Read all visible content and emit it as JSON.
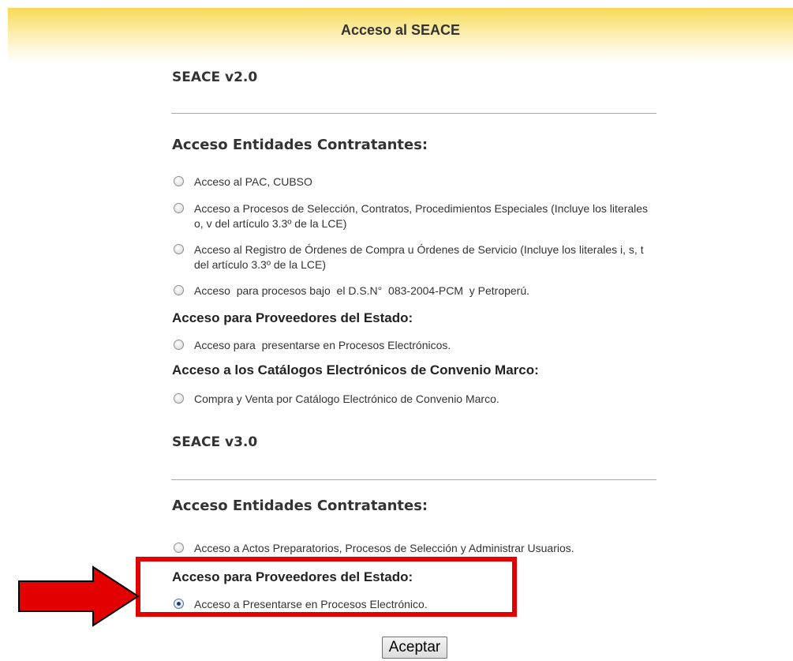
{
  "header": {
    "title": "Acceso al SEACE"
  },
  "v2": {
    "title": "SEACE v2.0",
    "entidades": {
      "title": "Acceso Entidades Contratantes:",
      "options": [
        {
          "label": "Acceso al PAC, CUBSO",
          "checked": false
        },
        {
          "label": "Acceso a Procesos de Selección, Contratos, Procedimientos Especiales (Incluye los literales o, v del artículo 3.3º de la LCE)",
          "checked": false
        },
        {
          "label": "Acceso al Registro de Órdenes de Compra u Órdenes de Servicio (Incluye los literales i, s, t del artículo 3.3º de la LCE)",
          "checked": false
        },
        {
          "label": "Acceso  para procesos bajo  el D.S.N°  083-2004-PCM  y Petroperú.",
          "checked": false
        }
      ]
    },
    "proveedores": {
      "title": "Acceso para Proveedores del Estado:",
      "options": [
        {
          "label": "Acceso para  presentarse en Procesos Electrónicos.",
          "checked": false
        }
      ]
    },
    "catalogos": {
      "title": "Acceso a los Catálogos Electrónicos de Convenio Marco:",
      "options": [
        {
          "label": "Compra y Venta por Catálogo Electrónico de Convenio Marco.",
          "checked": false
        }
      ]
    }
  },
  "v3": {
    "title": "SEACE v3.0",
    "entidades": {
      "title": "Acceso Entidades Contratantes:",
      "options": [
        {
          "label": "Acceso a Actos Preparatorios, Procesos de Selección y Administrar Usuarios.",
          "checked": false
        }
      ]
    },
    "proveedores": {
      "title": "Acceso para Proveedores del Estado:",
      "options": [
        {
          "label": "Acceso a Presentarse en Procesos Electrónico.",
          "checked": true
        }
      ]
    }
  },
  "actions": {
    "accept_label": "Aceptar"
  },
  "annotations": {
    "highlight_color": "#e20000",
    "arrow_color": "#e20000"
  }
}
